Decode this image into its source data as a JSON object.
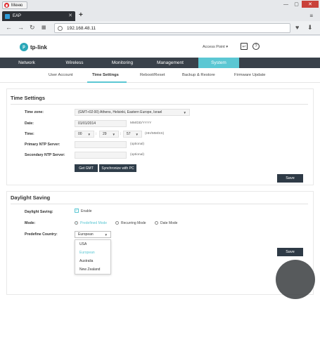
{
  "browser": {
    "menu_label": "Меню",
    "tab_title": "EAP",
    "new_tab": "+",
    "url": "192.168.48.11"
  },
  "header": {
    "logo_text": "tp-link",
    "mode_select": "Access Point ▾",
    "logout_icon": "logout-icon",
    "help_icon": "help-icon"
  },
  "nav": {
    "items": [
      "Network",
      "Wireless",
      "Monitoring",
      "Management",
      "System"
    ],
    "active": "System"
  },
  "subnav": {
    "items": [
      "User Account",
      "Time Settings",
      "Reboot/Reset",
      "Backup & Restore",
      "Firmware Update"
    ],
    "active": "Time Settings"
  },
  "time_settings": {
    "title": "Time Settings",
    "timezone_label": "Time zone:",
    "timezone_value": "(GMT+02:00) Athens, Helsinki, Eastern Europe, Israel",
    "date_label": "Date:",
    "date_value": "01/01/2014",
    "date_hint": "MM/DD/YYYY",
    "time_label": "Time:",
    "time_hh": "00",
    "time_mm": "29",
    "time_ss": "57",
    "time_hint": "(HH/MM/SS)",
    "primary_ntp_label": "Primary NTP Server:",
    "primary_ntp_value": "",
    "primary_ntp_hint": "(optional)",
    "secondary_ntp_label": "Secondary NTP Server:",
    "secondary_ntp_value": "",
    "secondary_ntp_hint": "(optional)",
    "get_gmt_label": "Get GMT",
    "sync_pc_label": "Synchronize with PC",
    "save_label": "Save"
  },
  "daylight_saving": {
    "title": "Daylight Saving",
    "ds_label": "Daylight Saving:",
    "enable_label": "Enable",
    "enabled": true,
    "mode_label": "Mode:",
    "modes": [
      "Predefined Mode",
      "Recurring Mode",
      "Date Mode"
    ],
    "mode_selected": "Predefined Mode",
    "country_label": "Predefine Country:",
    "country_value": "European",
    "country_options": [
      "USA",
      "European",
      "Australia",
      "New Zealand"
    ],
    "save_label": "Save"
  },
  "colors": {
    "accent": "#5bc7d3",
    "nav_bg": "#39414a",
    "button_dark": "#2e3a46"
  }
}
